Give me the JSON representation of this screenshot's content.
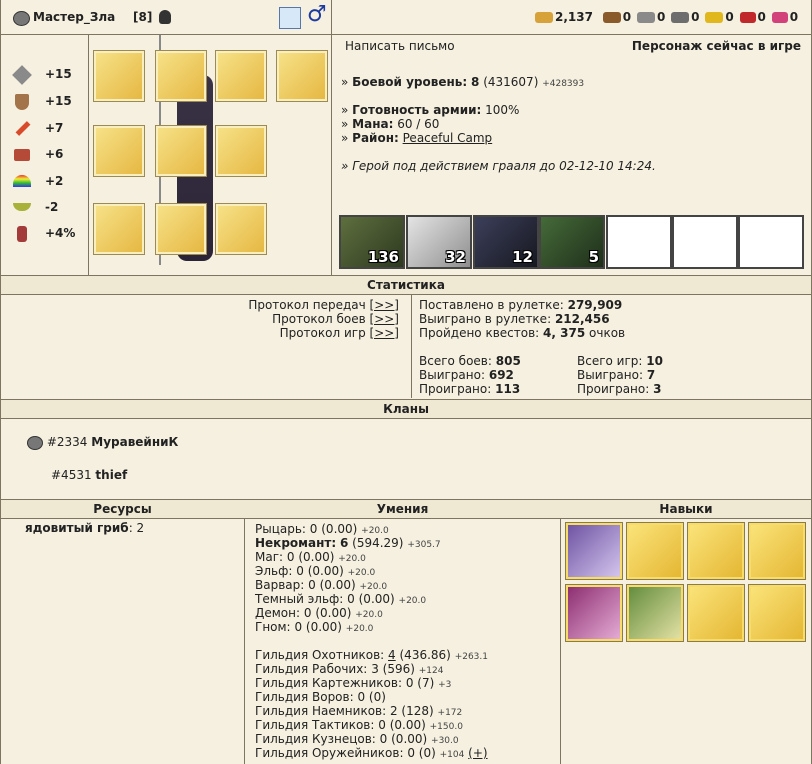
{
  "header": {
    "name": "Мастер_Зла",
    "level": "[8]",
    "resources": [
      {
        "icon": "gold-icon",
        "value": "2,137",
        "color": "#d8a23a"
      },
      {
        "icon": "wood-icon",
        "value": "0",
        "color": "#8b5a2b"
      },
      {
        "icon": "ore-icon",
        "value": "0",
        "color": "#8a8a8a"
      },
      {
        "icon": "mercury-icon",
        "value": "0",
        "color": "#6d6d6d"
      },
      {
        "icon": "sulfur-icon",
        "value": "0",
        "color": "#e0b81e"
      },
      {
        "icon": "crystal-icon",
        "value": "0",
        "color": "#c0282b"
      },
      {
        "icon": "gem-icon",
        "value": "0",
        "color": "#d3417a"
      }
    ]
  },
  "stats": [
    {
      "icon": "attack-icon",
      "value": "+15",
      "color": "#8a8a8a"
    },
    {
      "icon": "defense-icon",
      "value": "+15",
      "color": "#a3744a"
    },
    {
      "icon": "spellpower-icon",
      "value": "+7",
      "color": "#d94a2a"
    },
    {
      "icon": "knowledge-icon",
      "value": "+6",
      "color": "#b64a38"
    },
    {
      "icon": "luck-icon",
      "value": "+2",
      "color": "#3a8fd8"
    },
    {
      "icon": "morale-icon",
      "value": "-2",
      "color": "#a8b23a"
    },
    {
      "icon": "initiative-icon",
      "value": "+4%",
      "color": "#a43b3b"
    }
  ],
  "equipment": [
    {
      "name": "ring-slot"
    },
    {
      "name": "helmet-slot"
    },
    {
      "name": "medal-slot"
    },
    {
      "name": "book-slot"
    },
    {
      "name": "gold-ring-slot"
    },
    {
      "name": "armor-slot"
    },
    {
      "name": "cape-slot"
    },
    {
      "name": "scythe-slot"
    },
    {
      "name": "boots-slot"
    },
    {
      "name": "shield-slot"
    }
  ],
  "info": {
    "write_letter": "Написать письмо",
    "status": "Персонаж сейчас в игре",
    "combat_level_label": "Боевой уровень:",
    "combat_level": "8",
    "combat_exp": "(431607)",
    "combat_exp_small": "+428393",
    "army_label": "Готовность армии:",
    "army_value": "100%",
    "mana_label": "Мана:",
    "mana_value": "60 / 60",
    "district_label": "Район:",
    "district_value": "Peaceful Camp",
    "grail": "» Герой под действием грааля до 02-12-10 14:24."
  },
  "army": [
    {
      "count": "136"
    },
    {
      "count": "32"
    },
    {
      "count": "12"
    },
    {
      "count": "5"
    },
    {
      "count": ""
    },
    {
      "count": ""
    },
    {
      "count": ""
    }
  ],
  "statistics": {
    "title": "Статистика",
    "protocols": [
      {
        "label": "Протокол передач",
        "link": "[>>]"
      },
      {
        "label": "Протокол боев",
        "link": "[>>]"
      },
      {
        "label": "Протокол игр",
        "link": "[>>]"
      }
    ],
    "roulette_bet_label": "Поставлено в рулетке:",
    "roulette_bet": "279,909",
    "roulette_won_label": "Выиграно в рулетке:",
    "roulette_won": "212,456",
    "quests_label": "Пройдено квестов:",
    "quests_value": "4, 375",
    "quests_unit": "очков",
    "battles_total_label": "Всего боев:",
    "battles_total": "805",
    "battles_won_label": "Выиграно:",
    "battles_won": "692",
    "battles_lost_label": "Проиграно:",
    "battles_lost": "113",
    "games_total_label": "Всего игр:",
    "games_total": "10",
    "games_won_label": "Выиграно:",
    "games_won": "7",
    "games_lost_label": "Проиграно:",
    "games_lost": "3"
  },
  "clans": {
    "title": "Кланы",
    "items": [
      {
        "id": "#2334",
        "name": "МуравейниК"
      },
      {
        "id": "#4531",
        "name": "thief"
      }
    ]
  },
  "resources": {
    "title": "Ресурсы",
    "items": [
      {
        "name": "ядовитый гриб",
        "value": ": 2"
      }
    ]
  },
  "skills": {
    "title": "Умения",
    "factions": [
      {
        "name": "Рыцарь:",
        "value": "0 (0.00)",
        "delta": "+20.0",
        "bold": false
      },
      {
        "name": "Некромант:",
        "value": "6",
        "extra": "(594.29)",
        "delta": "+305.7",
        "bold": true
      },
      {
        "name": "Маг:",
        "value": "0 (0.00)",
        "delta": "+20.0",
        "bold": false
      },
      {
        "name": "Эльф:",
        "value": "0 (0.00)",
        "delta": "+20.0",
        "bold": false
      },
      {
        "name": "Варвар:",
        "value": "0 (0.00)",
        "delta": "+20.0",
        "bold": false
      },
      {
        "name": "Темный эльф:",
        "value": "0 (0.00)",
        "delta": "+20.0",
        "bold": false
      },
      {
        "name": "Демон:",
        "value": "0 (0.00)",
        "delta": "+20.0",
        "bold": false
      },
      {
        "name": "Гном:",
        "value": "0 (0.00)",
        "delta": "+20.0",
        "bold": false
      }
    ],
    "guilds": [
      {
        "name": "Гильдия Охотников:",
        "link": "4",
        "value": " (436.86)",
        "delta": "+263.1"
      },
      {
        "name": "Гильдия Рабочих:",
        "value": "3 (596)",
        "delta": "+124"
      },
      {
        "name": "Гильдия Картежников:",
        "value": "0 (7)",
        "delta": "+3"
      },
      {
        "name": "Гильдия Воров:",
        "value": "0 (0)",
        "delta": ""
      },
      {
        "name": "Гильдия Наемников:",
        "value": "2 (128)",
        "delta": "+172"
      },
      {
        "name": "Гильдия Тактиков:",
        "value": "0 (0.00)",
        "delta": "+150.0"
      },
      {
        "name": "Гильдия Кузнецов:",
        "value": "0 (0.00)",
        "delta": "+30.0"
      },
      {
        "name": "Гильдия Оружейников:",
        "value": "0 (0)",
        "delta": "+104",
        "plus": "(+)"
      }
    ]
  },
  "talents": {
    "title": "Навыки"
  }
}
